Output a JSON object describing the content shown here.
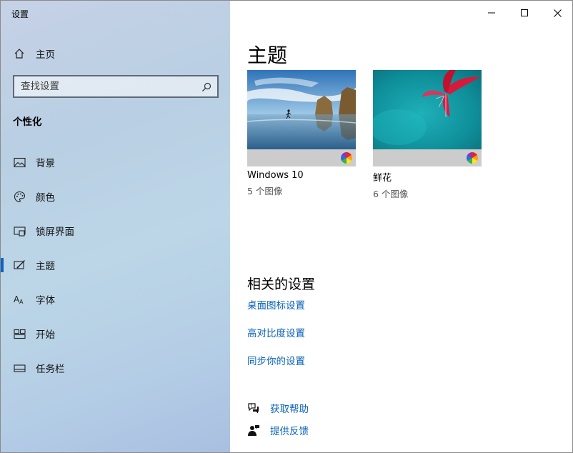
{
  "window": {
    "title": "设置"
  },
  "sidebar": {
    "home_label": "主页",
    "search_placeholder": "查找设置",
    "section_title": "个性化",
    "items": [
      {
        "label": "背景",
        "icon": "picture-icon"
      },
      {
        "label": "颜色",
        "icon": "palette-icon"
      },
      {
        "label": "锁屏界面",
        "icon": "lock-screen-icon"
      },
      {
        "label": "主题",
        "icon": "theme-icon",
        "active": true
      },
      {
        "label": "字体",
        "icon": "font-icon"
      },
      {
        "label": "开始",
        "icon": "start-icon"
      },
      {
        "label": "任务栏",
        "icon": "taskbar-icon"
      }
    ]
  },
  "main": {
    "title": "主题",
    "themes": [
      {
        "name": "Windows 10",
        "count": "5 个图像"
      },
      {
        "name": "鲜花",
        "count": "6 个图像"
      }
    ],
    "related_title": "相关的设置",
    "related_links": [
      "桌面图标设置",
      "高对比度设置",
      "同步你的设置"
    ],
    "help": {
      "get_help": "获取帮助",
      "feedback": "提供反馈"
    }
  },
  "colors": {
    "accent": "#0a62b8",
    "active_indicator": "#0b63c4"
  }
}
